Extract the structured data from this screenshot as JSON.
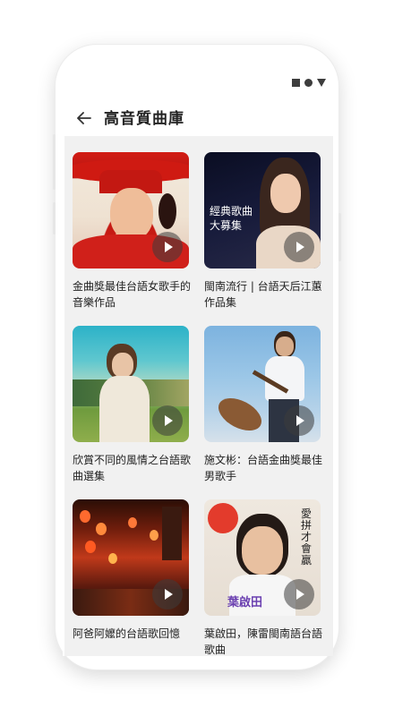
{
  "status_bar": {
    "icons": [
      "square-icon",
      "circle-icon",
      "triangle-icon"
    ]
  },
  "header": {
    "title": "高音質曲庫",
    "back_icon": "arrow-left-icon"
  },
  "albums": [
    {
      "title": "金曲獎最佳台語女歌手的音樂作品",
      "cover_text": ""
    },
    {
      "title": "閩南流行 | 台語天后江蕙作品集",
      "cover_text": "經典歌曲大募集"
    },
    {
      "title": "欣賞不同的風情之台語歌曲選集",
      "cover_text": ""
    },
    {
      "title": "施文彬：台語金曲獎最佳男歌手",
      "cover_text": ""
    },
    {
      "title": "阿爸阿嬤的台語歌回憶",
      "cover_text": ""
    },
    {
      "title": "葉啟田，陳雷閩南語台語歌曲",
      "cover_text": "愛拼才會贏",
      "cover_name": "葉啟田"
    }
  ],
  "colors": {
    "background": "#f1f1f1",
    "accent_play": "#3c3c3c"
  }
}
